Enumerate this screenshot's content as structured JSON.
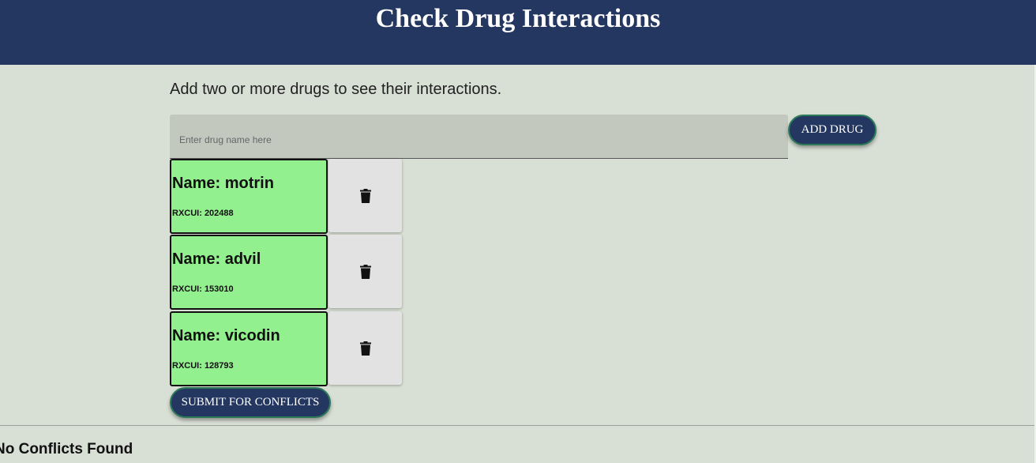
{
  "header": {
    "title": "Check Drug Interactions"
  },
  "intro_text": "Add two or more drugs to see their interactions.",
  "search": {
    "placeholder": "Enter drug name here",
    "value": ""
  },
  "add_button_label": "ADD DRUG",
  "drugs": [
    {
      "name_text": "Name: motrin",
      "rxcui_text": "RXCUI: 202488"
    },
    {
      "name_text": "Name: advil",
      "rxcui_text": "RXCUI: 153010"
    },
    {
      "name_text": "Name: vicodin",
      "rxcui_text": "RXCUI: 128793"
    }
  ],
  "submit_button_label": "SUBMIT FOR CONFLICTS",
  "result_text": "No Conflicts Found",
  "colors": {
    "header_bg": "#243760",
    "page_bg": "#d8dfd4",
    "card_bg": "#93f08e",
    "button_border": "#2a7a5a"
  },
  "icons": {
    "delete": "trash-icon"
  }
}
